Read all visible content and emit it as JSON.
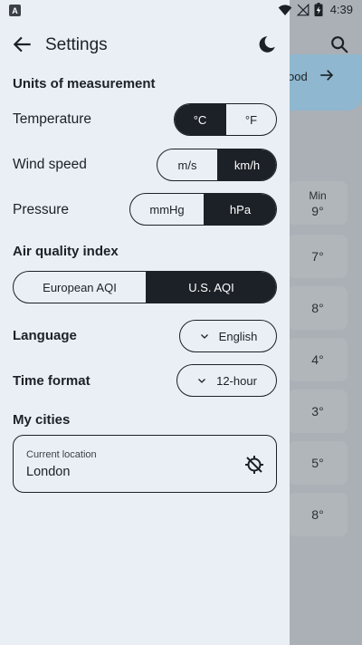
{
  "background": {
    "card_text": "ood",
    "min_label": "Min",
    "min_values": [
      "9°",
      "7°",
      "8°",
      "4°",
      "3°",
      "5°",
      "8°"
    ]
  },
  "status_bar": {
    "time": "4:39",
    "app_badge": "A"
  },
  "header": {
    "title": "Settings"
  },
  "units": {
    "section_title": "Units of measurement",
    "temperature": {
      "label": "Temperature",
      "options": [
        "°C",
        "°F"
      ],
      "selected": 0
    },
    "wind_speed": {
      "label": "Wind speed",
      "options": [
        "m/s",
        "km/h"
      ],
      "selected": 1
    },
    "pressure": {
      "label": "Pressure",
      "options": [
        "mmHg",
        "hPa"
      ],
      "selected": 1
    }
  },
  "aqi": {
    "section_title": "Air quality index",
    "options": [
      "European AQI",
      "U.S. AQI"
    ],
    "selected": 1
  },
  "language": {
    "label": "Language",
    "value": "English"
  },
  "time_format": {
    "label": "Time format",
    "value": "12-hour"
  },
  "cities": {
    "section_title": "My cities",
    "current": {
      "caption": "Current location",
      "name": "London"
    }
  },
  "colors": {
    "drawer_bg": "#e9eff5",
    "selected": "#1c2127",
    "scrim": "#aab0b6"
  }
}
